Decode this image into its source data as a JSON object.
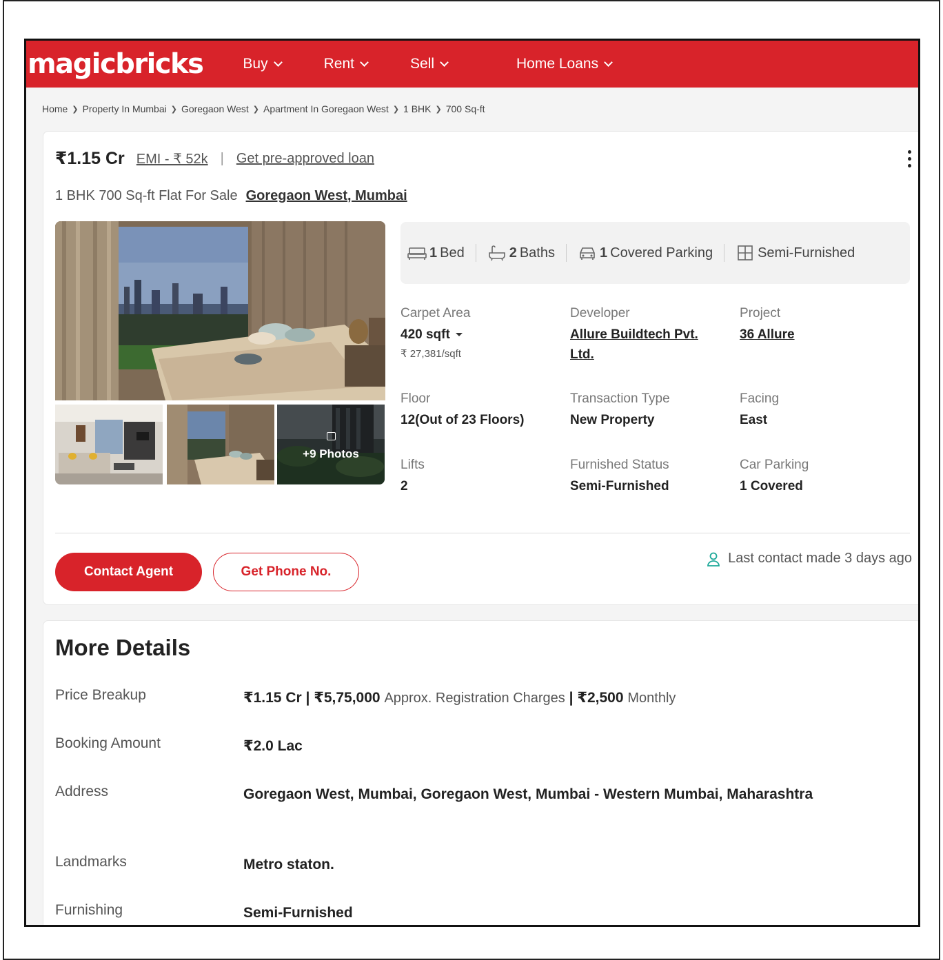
{
  "header": {
    "logo": "magicbricks",
    "nav": [
      {
        "label": "Buy"
      },
      {
        "label": "Rent"
      },
      {
        "label": "Sell"
      },
      {
        "label": "Home Loans"
      }
    ],
    "brand_color": "#d8232a"
  },
  "breadcrumb": [
    "Home",
    "Property In Mumbai",
    "Goregaon West",
    "Apartment In Goregaon West",
    "1 BHK",
    "700 Sq-ft"
  ],
  "listing": {
    "price": "₹1.15 Cr",
    "emi": "EMI - ₹ 52k",
    "separator": "|",
    "loan_link": "Get pre-approved loan",
    "title": "1 BHK 700 Sq-ft Flat For Sale",
    "location": "Goregaon West, Mumbai",
    "photos_more": "+9 Photos",
    "summary": {
      "bed_count": "1",
      "bed_label": "Bed",
      "bath_count": "2",
      "bath_label": "Baths",
      "parking_count": "1",
      "parking_label": "Covered Parking",
      "furnishing": "Semi-Furnished"
    },
    "details": {
      "carpet_label": "Carpet Area",
      "carpet_value": "420 sqft",
      "carpet_rate": "₹ 27,381/sqft",
      "developer_label": "Developer",
      "developer_value": "Allure Buildtech Pvt. Ltd.",
      "project_label": "Project",
      "project_value": "36 Allure",
      "floor_label": "Floor",
      "floor_value": "12(Out of 23 Floors)",
      "transaction_label": "Transaction Type",
      "transaction_value": "New Property",
      "facing_label": "Facing",
      "facing_value": "East",
      "lifts_label": "Lifts",
      "lifts_value": "2",
      "furnished_label": "Furnished Status",
      "furnished_value": "Semi-Furnished",
      "car_parking_label": "Car Parking",
      "car_parking_value": "1 Covered"
    },
    "contact_button": "Contact Agent",
    "phone_button": "Get Phone No.",
    "last_contact": "Last contact made 3 days ago"
  },
  "more_details": {
    "title": "More Details",
    "price_breakup_label": "Price Breakup",
    "price_breakup_price": "₹1.15 Cr",
    "price_breakup_sep1": "|",
    "price_breakup_reg": "₹5,75,000",
    "price_breakup_reg_label": "Approx. Registration Charges",
    "price_breakup_sep2": "|",
    "price_breakup_monthly": "₹2,500",
    "price_breakup_monthly_label": "Monthly",
    "booking_label": "Booking Amount",
    "booking_value": "₹2.0 Lac",
    "address_label": "Address",
    "address_value": "Goregaon West, Mumbai, Goregaon West, Mumbai - Western Mumbai, Maharashtra",
    "landmarks_label": "Landmarks",
    "landmarks_value": "Metro staton.",
    "furnishing_label": "Furnishing",
    "furnishing_value": "Semi-Furnished"
  }
}
